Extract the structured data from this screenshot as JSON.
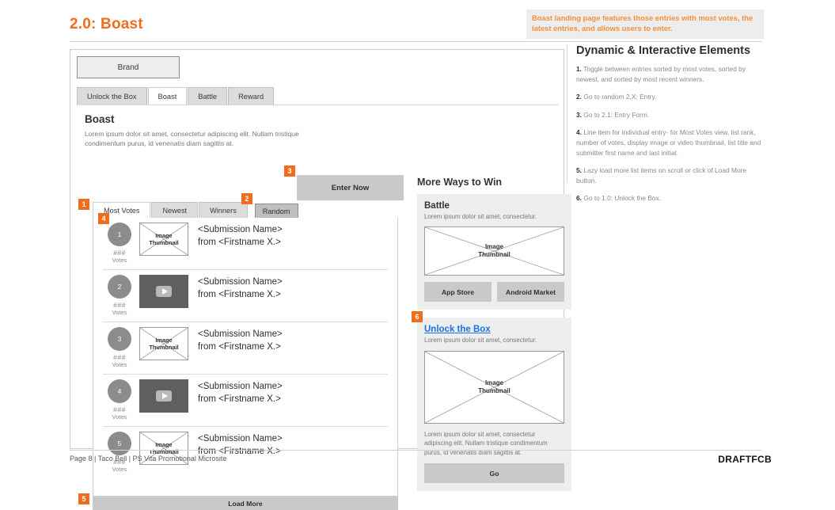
{
  "header": {
    "title": "2.0: Boast",
    "annotation": "Boast landing page features those entries with most votes, the latest entries, and allows users to enter.",
    "accent_color": "#f26c1e"
  },
  "wireframe": {
    "brand_label": "Brand",
    "main_nav": [
      {
        "label": "Unlock the Box",
        "active": false
      },
      {
        "label": "Boast",
        "active": true
      },
      {
        "label": "Battle",
        "active": false
      },
      {
        "label": "Reward",
        "active": false
      }
    ],
    "page_heading": "Boast",
    "page_lede": "Lorem ipsum dolor sit amet, consectetur adipiscing elit. Nullam tristique condimentum purus, id venenatis diam sagittis at.",
    "enter_now_label": "Enter Now",
    "sub_tabs": [
      {
        "label": "Most Votes",
        "active": true
      },
      {
        "label": "Newest",
        "active": false
      },
      {
        "label": "Winners",
        "active": false
      }
    ],
    "random_label": "Random",
    "entries": [
      {
        "rank": "1",
        "votes_number": "###",
        "votes_label": "Votes",
        "thumb_type": "image",
        "thumb_label_1": "Image",
        "thumb_label_2": "Thumbnail",
        "title": "<Submission Name>",
        "byline": "from <Firstname X.>"
      },
      {
        "rank": "2",
        "votes_number": "###",
        "votes_label": "Votes",
        "thumb_type": "video",
        "thumb_label_1": "",
        "thumb_label_2": "",
        "title": "<Submission Name>",
        "byline": "from <Firstname X.>"
      },
      {
        "rank": "3",
        "votes_number": "###",
        "votes_label": "Votes",
        "thumb_type": "image",
        "thumb_label_1": "Image",
        "thumb_label_2": "Thumbnail",
        "title": "<Submission Name>",
        "byline": "from <Firstname X.>"
      },
      {
        "rank": "4",
        "votes_number": "###",
        "votes_label": "Votes",
        "thumb_type": "video",
        "thumb_label_1": "",
        "thumb_label_2": "",
        "title": "<Submission Name>",
        "byline": "from <Firstname X.>"
      },
      {
        "rank": "5",
        "votes_number": "###",
        "votes_label": "Votes",
        "thumb_type": "image",
        "thumb_label_1": "Image",
        "thumb_label_2": "Thumbnail",
        "title": "<Submission Name>",
        "byline": "from <Firstname X.>"
      }
    ],
    "load_more_label": "Load More",
    "more_ways": {
      "heading": "More Ways to Win",
      "battle": {
        "title": "Battle",
        "body": "Lorem ipsum dolor sit amet, consectetur.",
        "thumb_label_1": "Image",
        "thumb_label_2": "Thumbnail",
        "app_store_label": "App Store",
        "android_label": "Android Market"
      },
      "unlock": {
        "title": "Unlock the Box",
        "body": "Lorem ipsum dolor sit amet, consectetur.",
        "thumb_label_1": "Image",
        "thumb_label_2": "Thumbnail",
        "body2": "Lorem ipsum dolor sit amet, consectetur adipiscing elit. Nullam tristique condimentum purus, id venenatis diam sagittis at.",
        "go_label": "Go",
        "link_color": "#1973e8"
      }
    },
    "badges": [
      "1",
      "2",
      "3",
      "4",
      "5",
      "6"
    ]
  },
  "spec": {
    "title": "Dynamic & Interactive Elements",
    "items": [
      {
        "num": "1.",
        "text": "Toggle between entries sorted by most votes, sorted by newest, and sorted by most recent winners."
      },
      {
        "num": "2.",
        "text": "Go to random 2.X: Entry."
      },
      {
        "num": "3.",
        "text": "Go to 2.1: Entry Form."
      },
      {
        "num": "4.",
        "text": "Line item for individual entry- for Most Votes view, list rank, number of votes, display image or video thumbnail, list title and submitter first name and last initial."
      },
      {
        "num": "5.",
        "text": "Lazy load more list items on scroll or click of Load More button."
      },
      {
        "num": "6.",
        "text": "Go to 1.0: Unlock the Box."
      }
    ]
  },
  "footer": {
    "left": "Page 8 | Taco Bell | PS Vita Promotional Microsite",
    "logo": "DRAFTFCB"
  }
}
